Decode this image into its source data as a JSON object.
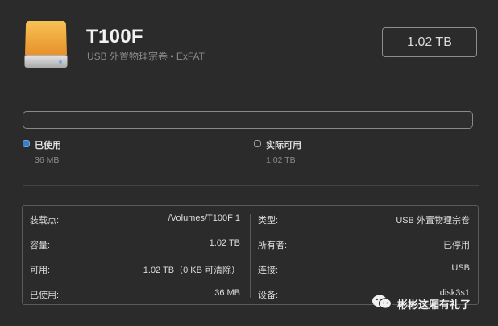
{
  "volume": {
    "name": "T100F",
    "subtitle": "USB 外置物理宗卷 • ExFAT",
    "capacity": "1.02 TB"
  },
  "usage": {
    "used_label": "已使用",
    "used_value": "36 MB",
    "used_color": "#3b7dc4",
    "available_label": "实际可用",
    "available_value": "1.02 TB"
  },
  "info": {
    "left": [
      {
        "key": "装载点:",
        "value": "/Volumes/T100F 1"
      },
      {
        "key": "容量:",
        "value": "1.02 TB"
      },
      {
        "key": "可用:",
        "value": "1.02 TB（0 KB 可清除）"
      },
      {
        "key": "已使用:",
        "value": "36 MB"
      }
    ],
    "right": [
      {
        "key": "类型:",
        "value": "USB 外置物理宗卷"
      },
      {
        "key": "所有者:",
        "value": "已停用"
      },
      {
        "key": "连接:",
        "value": "USB"
      },
      {
        "key": "设备:",
        "value": "disk3s1"
      }
    ]
  },
  "watermark": {
    "text": "彬彬这厢有礼了",
    "icon": "wechat-icon"
  },
  "colors": {
    "background": "#2b2b2b",
    "drive_orange": "#f0a63a",
    "drive_silver": "#cfcfcf"
  }
}
